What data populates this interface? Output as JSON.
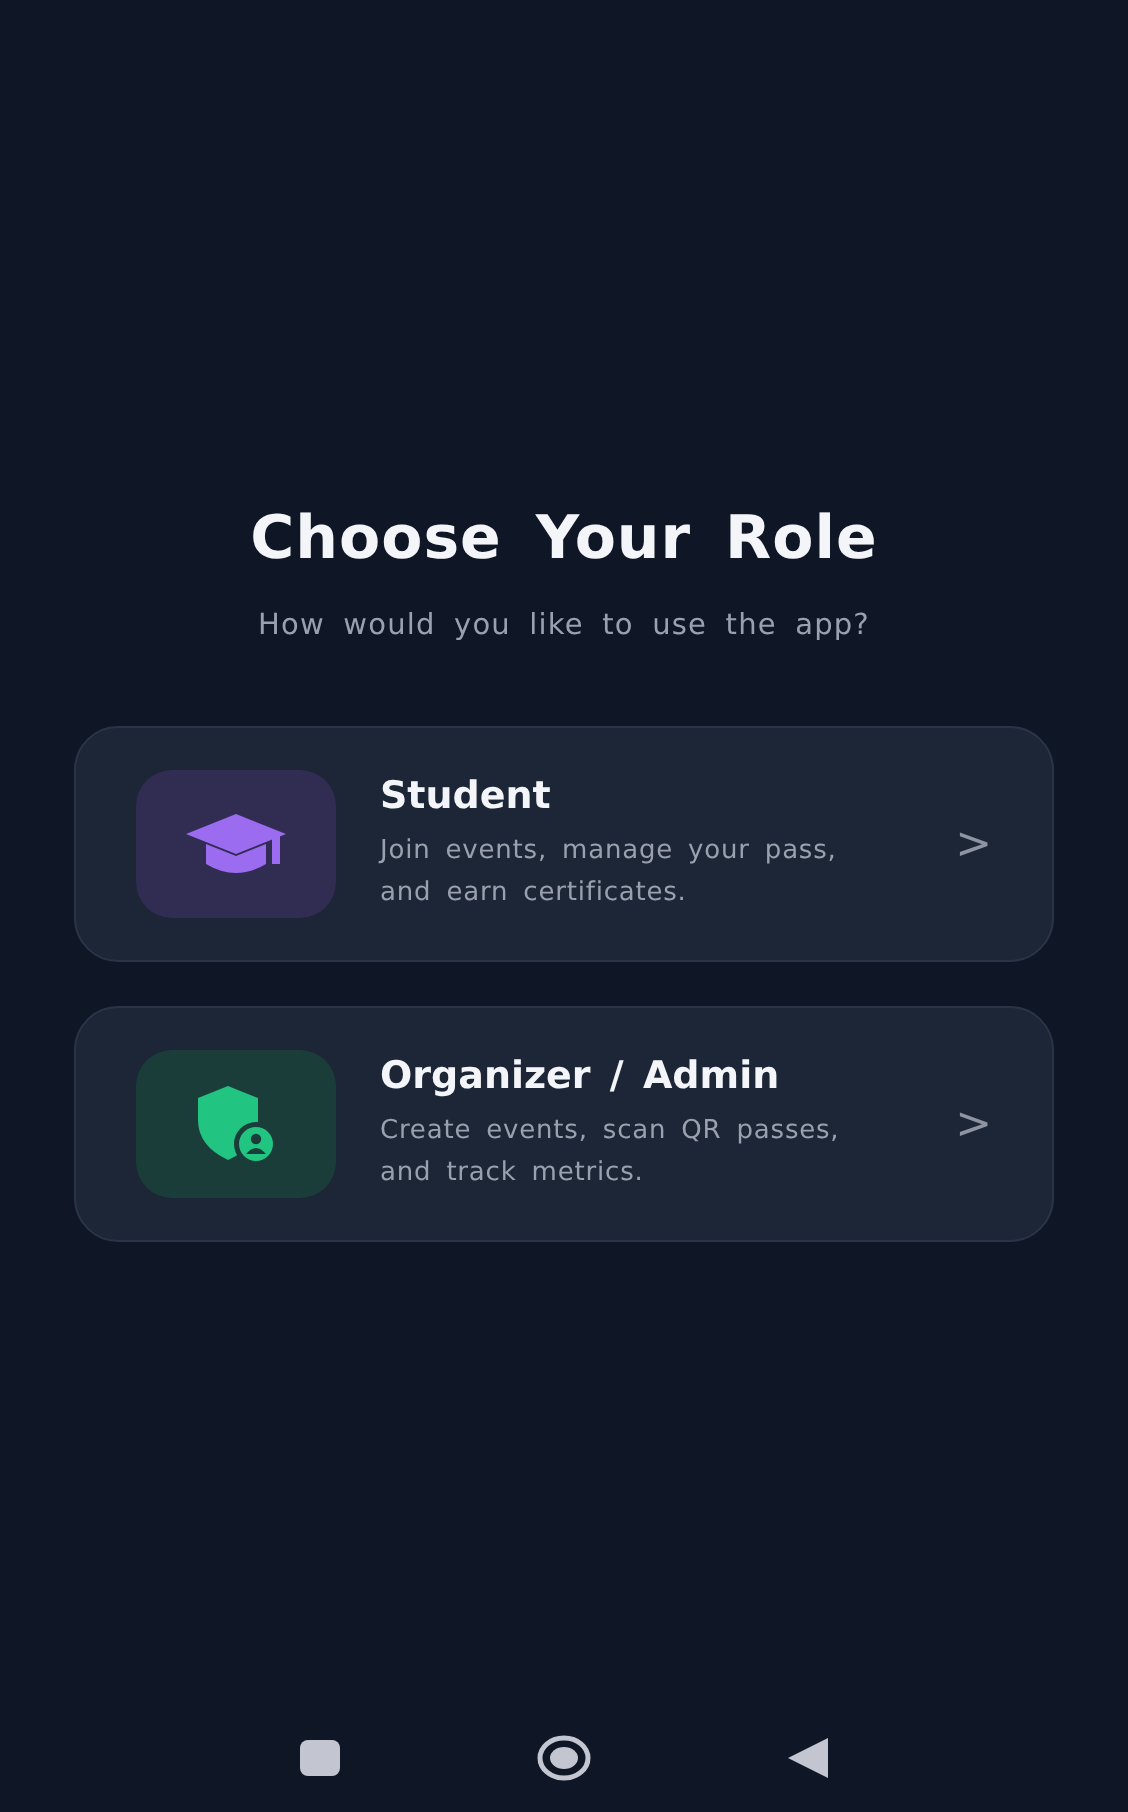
{
  "title": "Choose Your Role",
  "subtitle": "How would you like to use the app?",
  "roles": [
    {
      "kind": "student",
      "name": "Student",
      "description": "Join events, manage your pass, and earn certificates.",
      "chevron": ">"
    },
    {
      "kind": "organizer",
      "name": "Organizer / Admin",
      "description": "Create events, scan QR passes, and track metrics.",
      "chevron": ">"
    }
  ]
}
